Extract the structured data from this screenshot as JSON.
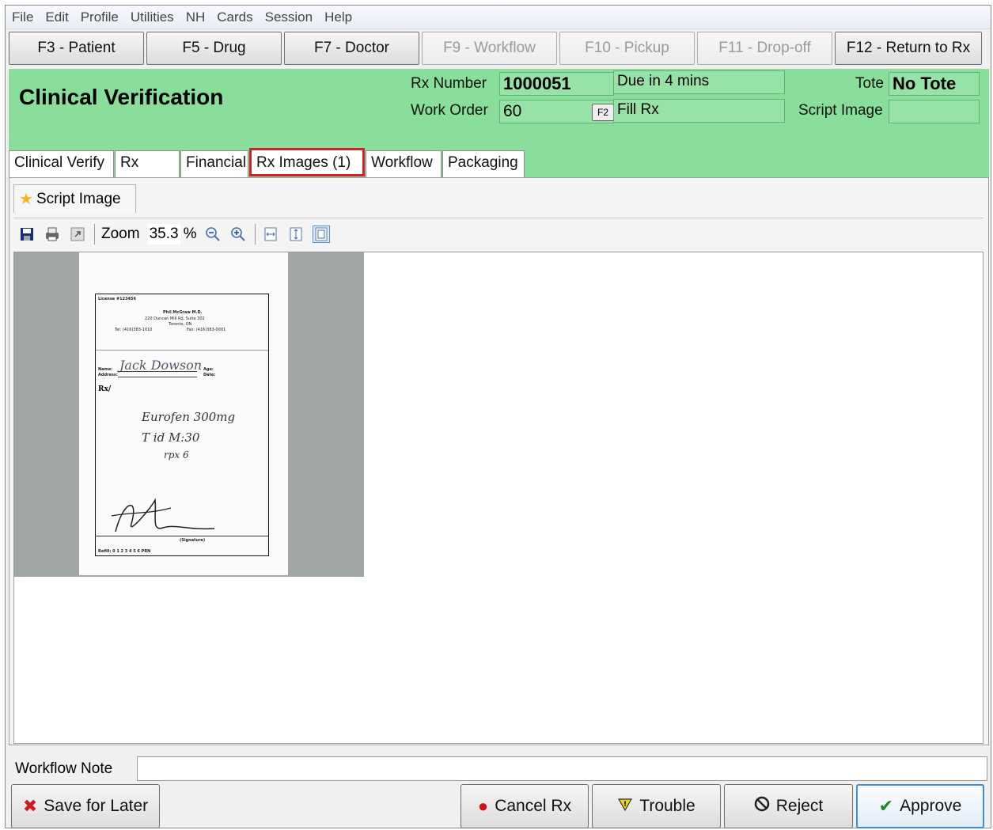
{
  "menu": [
    "File",
    "Edit",
    "Profile",
    "Utilities",
    "NH",
    "Cards",
    "Session",
    "Help"
  ],
  "fkeys": [
    {
      "label": "F3 - Patient",
      "enabled": true
    },
    {
      "label": "F5 - Drug",
      "enabled": true
    },
    {
      "label": "F7 - Doctor",
      "enabled": true
    },
    {
      "label": "F9 - Workflow",
      "enabled": false
    },
    {
      "label": "F10 - Pickup",
      "enabled": false
    },
    {
      "label": "F11 - Drop-off",
      "enabled": false
    },
    {
      "label": "F12 - Return to Rx",
      "enabled": true
    }
  ],
  "header": {
    "title": "Clinical Verification",
    "rx_number_label": "Rx Number",
    "rx_number": "1000051",
    "due": "Due in 4 mins",
    "tote_label": "Tote",
    "tote": "No Tote",
    "work_order_label": "Work Order",
    "work_order": "60",
    "f2_label": "F2",
    "fill_rx": "Fill Rx",
    "script_image_label": "Script Image",
    "script_image": ""
  },
  "tabs": [
    "Clinical Verify",
    "Rx",
    "Financial",
    "Rx Images (1)",
    "Workflow",
    "Packaging"
  ],
  "active_tab": "Rx Images (1)",
  "subtab": "Script Image",
  "toolbar": {
    "zoom_label": "Zoom",
    "zoom_value": "35.3",
    "zoom_unit": "%"
  },
  "prescription": {
    "license": "License #123456",
    "doctor": "Phil McGraw M.D.",
    "address1": "220 Duncan Mill Rd, Suite 302",
    "address2": "Toronto, ON",
    "tel": "Tel: (416)383-1010",
    "fax": "Fax: (416)383-0001",
    "name_label": "Name:",
    "patient": "Jack Dowson",
    "age_label": "Age:",
    "date_label": "Date:",
    "address_label": "Address:",
    "rx_label": "Rx/",
    "line1": "Eurofen 300mg",
    "line2": "T id M:30",
    "line3": "rpx 6",
    "signature_label": "(Signature)",
    "refill": "Refill: 0 1 2 3 4 5 6 PRN"
  },
  "bottom": {
    "note_label": "Workflow Note",
    "note_value": "",
    "save_later": "Save for Later",
    "cancel": "Cancel Rx",
    "trouble": "Trouble",
    "reject": "Reject",
    "approve": "Approve"
  },
  "colors": {
    "header_green": "#88de9a",
    "active_tab_border": "#d0232b",
    "approve_border": "#3c8fd6"
  }
}
